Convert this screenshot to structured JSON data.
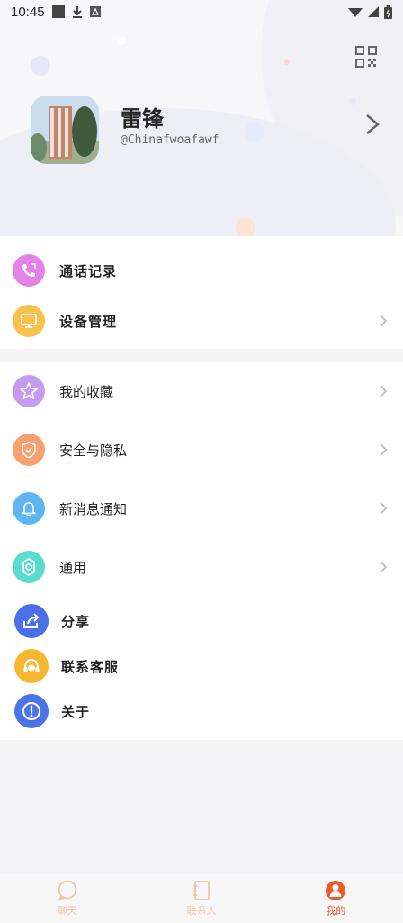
{
  "status_bar": {
    "time": "10:45"
  },
  "profile": {
    "name": "雷锋",
    "handle": "@Chinafwoafawf"
  },
  "group1": [
    {
      "label": "通话记录",
      "icon": "phone-icon",
      "color": "#e383e8",
      "chevron": false
    },
    {
      "label": "设备管理",
      "icon": "monitor-icon",
      "color": "#f7c24c",
      "chevron": true
    }
  ],
  "group2": [
    {
      "label": "我的收藏",
      "icon": "star-icon",
      "color": "#c59bf2",
      "chevron": true
    },
    {
      "label": "安全与隐私",
      "icon": "shield-icon",
      "color": "#f7a070",
      "chevron": true
    },
    {
      "label": "新消息通知",
      "icon": "bell-icon",
      "color": "#5fb4f4",
      "chevron": true
    },
    {
      "label": "通用",
      "icon": "gear-icon",
      "color": "#58dcd0",
      "chevron": true
    },
    {
      "label": "分享",
      "icon": "share-icon",
      "color": "#4b6fe8",
      "chevron": false
    },
    {
      "label": "联系客服",
      "icon": "headset-icon",
      "color": "#f6b833",
      "chevron": false
    },
    {
      "label": "关于",
      "icon": "info-icon",
      "color": "#4b74e8",
      "chevron": false
    }
  ],
  "nav": {
    "tabs": [
      {
        "label": "聊天",
        "icon": "chat-icon"
      },
      {
        "label": "联系人",
        "icon": "contacts-icon"
      },
      {
        "label": "我的",
        "icon": "person-icon"
      }
    ],
    "active_index": 2,
    "active_color": "#f05a2a",
    "inactive_color": "#f6c2a8"
  }
}
